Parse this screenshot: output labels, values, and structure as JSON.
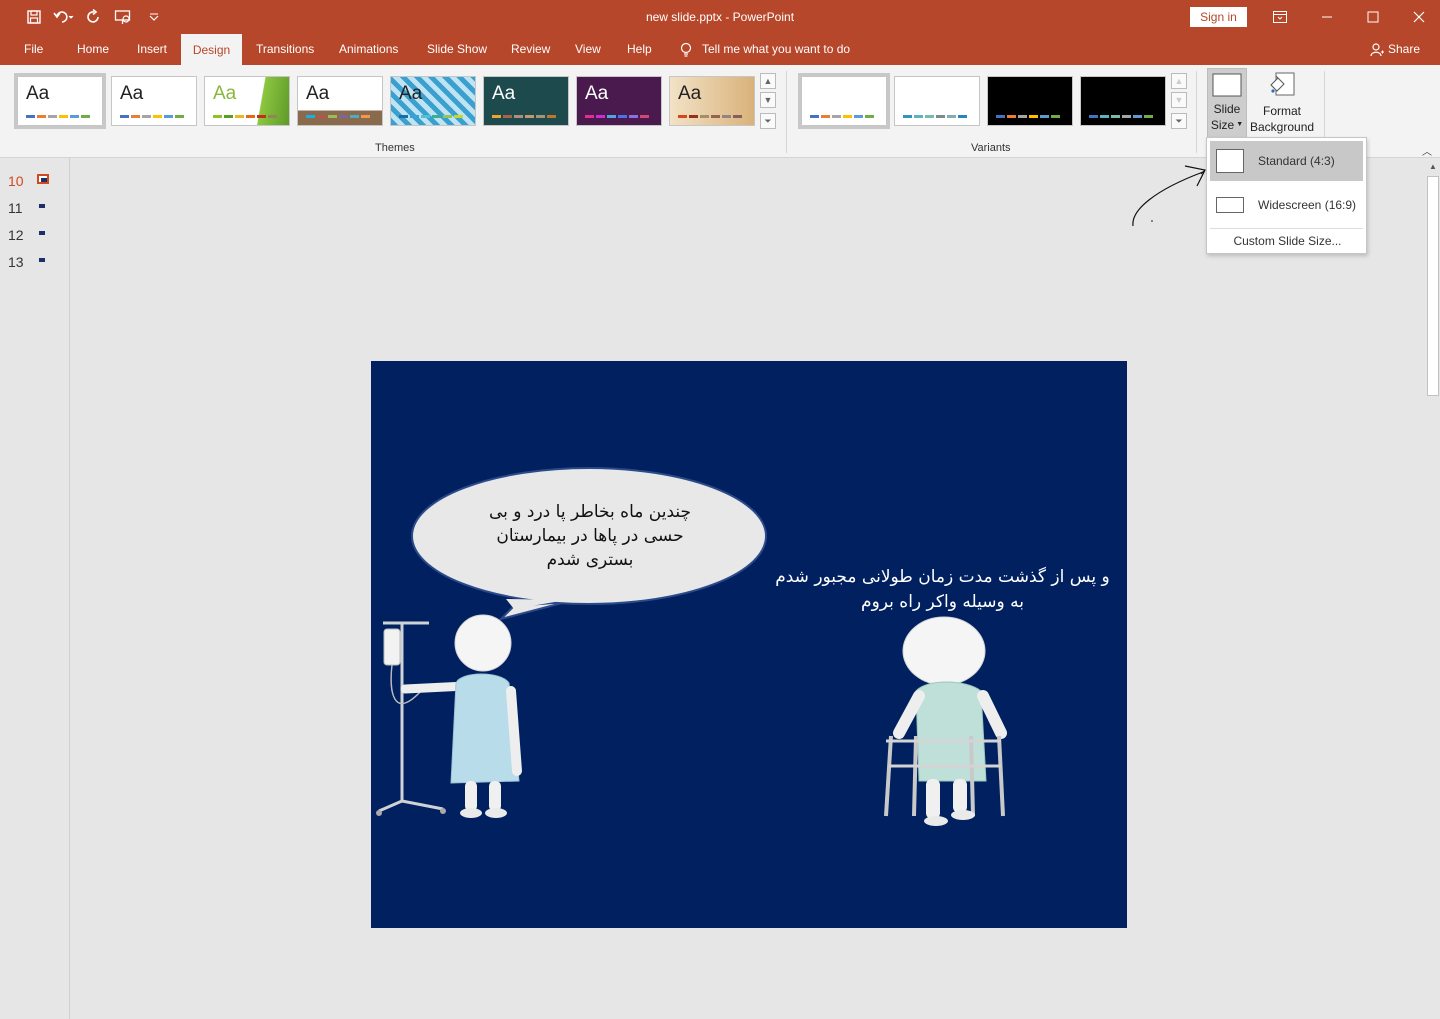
{
  "window": {
    "title": "new slide.pptx  -  PowerPoint",
    "signin_label": "Sign in"
  },
  "quick_access": [
    {
      "icon": "save-icon"
    },
    {
      "icon": "undo-icon"
    },
    {
      "icon": "redo-icon"
    },
    {
      "icon": "present-icon"
    },
    {
      "icon": "customize-qat-icon"
    }
  ],
  "tabs": [
    "File",
    "Home",
    "Insert",
    "Design",
    "Transitions",
    "Animations",
    "Slide Show",
    "Review",
    "View",
    "Help"
  ],
  "active_tab": "Design",
  "tell_me": "Tell me what you want to do",
  "share_label": "Share",
  "ribbon": {
    "themes_label": "Themes",
    "variants_label": "Variants",
    "theme_sample": "Aa",
    "slide_size_label_1": "Slide",
    "slide_size_label_2": "Size",
    "format_bg_label_1": "Format",
    "format_bg_label_2": "Background"
  },
  "slide_size_menu": {
    "standard": "Standard (4:3)",
    "widescreen": "Widescreen (16:9)",
    "custom": "Custom Slide Size..."
  },
  "slides_pane": [
    "10",
    "11",
    "12",
    "13"
  ],
  "active_slide": "10",
  "slide": {
    "bubble_line1": "چندین ماه بخاطر پا درد و بی",
    "bubble_line2": "حسی در پاها در بیمارستان",
    "bubble_line3": "بستری شدم",
    "caption_line1": "و پس از گذشت مدت زمان طولانی مجبور شدم",
    "caption_line2": "به وسیله واکر راه بروم"
  },
  "colors": {
    "accent": "#b7472a",
    "slide_bg": "#002060",
    "bubble_fill": "#e8e8e8"
  }
}
